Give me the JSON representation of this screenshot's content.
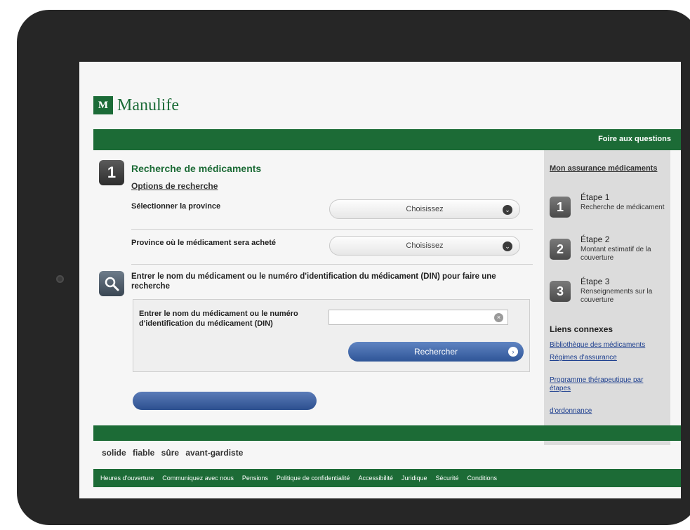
{
  "brand": {
    "logo_mark": "M",
    "logo_word": "Manulife"
  },
  "topbar": {
    "link": "Foire aux questions"
  },
  "main": {
    "step1": {
      "number": "1",
      "title": "Recherche de médicaments",
      "subtitle": "Options de recherche",
      "field1_label": "Sélectionner la province",
      "field1_value": "Choisissez",
      "field2_label": "Province où le médicament sera acheté",
      "field2_value": "Choisissez"
    },
    "step2": {
      "title_line1": "Entrer le nom du médicament ou le numéro d'identification du médicament (DIN) pour faire une",
      "title_line2": "recherche",
      "input_label_line1": "Entrer le nom du médicament ou le numéro",
      "input_label_line2": "d'identification du médicament (DIN)",
      "clear_symbol": "×",
      "search_button": "Rechercher",
      "go_symbol": "›",
      "dropdown_arrow": "⌄"
    }
  },
  "sidebar": {
    "title": "Mon assurance médicaments",
    "steps": [
      {
        "num": "1",
        "heading": "Étape 1",
        "text": "Recherche de médicament"
      },
      {
        "num": "2",
        "heading": "Étape 2",
        "text": "Montant estimatif de la couverture"
      },
      {
        "num": "3",
        "heading": "Étape 3",
        "text": "Renseignements sur la couverture"
      }
    ],
    "links_title": "Liens connexes",
    "links": [
      "Bibliothèque des médicaments",
      "Régimes d'assurance",
      "Programme thérapeutique par étapes",
      "d'ordonnance"
    ]
  },
  "footer": {
    "tagline": "solide fiable sûre avant-gardiste",
    "links": [
      "Heures d'ouverture",
      "Communiquez avec nous",
      "Pensions",
      "Politique de confidentialité",
      "Accessibilité",
      "Juridique",
      "Sécurité",
      "Conditions"
    ]
  },
  "colors": {
    "brand_green": "#1c6b36",
    "link_blue": "#1d3f8f",
    "button_blue": "#2f5597"
  },
  "icons": {
    "step_search": "magnifier-icon",
    "dropdown": "chevron-down-icon",
    "clear": "clear-icon"
  }
}
